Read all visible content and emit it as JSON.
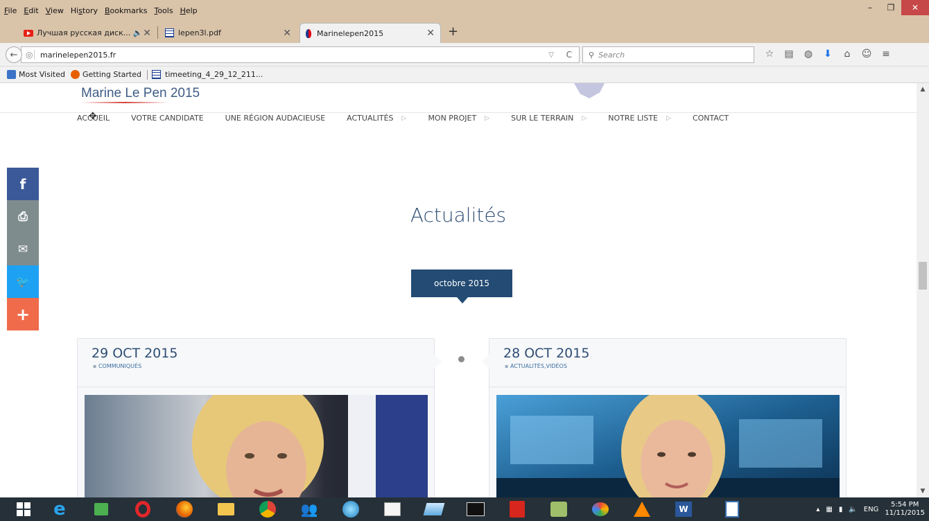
{
  "menubar": {
    "items": [
      {
        "pre": "",
        "u": "F",
        "post": "ile"
      },
      {
        "pre": "",
        "u": "E",
        "post": "dit"
      },
      {
        "pre": "",
        "u": "V",
        "post": "iew"
      },
      {
        "pre": "Hi",
        "u": "s",
        "post": "tory"
      },
      {
        "pre": "",
        "u": "B",
        "post": "ookmarks"
      },
      {
        "pre": "",
        "u": "T",
        "post": "ools"
      },
      {
        "pre": "",
        "u": "H",
        "post": "elp"
      }
    ]
  },
  "tabs": [
    {
      "label": "Лучшая русская диск... 🔈",
      "close": "✕"
    },
    {
      "label": "lepen3l.pdf",
      "close": "✕"
    },
    {
      "label": "Marinelepen2015",
      "close": "✕"
    }
  ],
  "new_tab": "+",
  "navbar": {
    "back": "←",
    "url": "marinelepen2015.fr",
    "search_placeholder": "Search",
    "dropdown": "▽",
    "reload": "C"
  },
  "toolbar_icons": [
    "☆",
    "▤",
    "◍",
    "⬇",
    "⌂",
    "☺",
    "≡"
  ],
  "bookmarks": [
    {
      "label": "Most Visited",
      "color": "#3b73c8"
    },
    {
      "label": "Getting Started",
      "color": "#e66000"
    },
    {
      "label": "timeeting_4_29_12_211...",
      "color": "#1b3d8f"
    }
  ],
  "site": {
    "logo": "Marine Le Pen 2015",
    "nav": [
      {
        "label": "ACCUEIL",
        "arrow": ""
      },
      {
        "label": "VOTRE CANDIDATE",
        "arrow": ""
      },
      {
        "label": "UNE RÉGION AUDACIEUSE",
        "arrow": ""
      },
      {
        "label": "ACTUALITÉS",
        "arrow": "▷"
      },
      {
        "label": "MON PROJET",
        "arrow": "▷"
      },
      {
        "label": "SUR LE TERRAIN",
        "arrow": "▷"
      },
      {
        "label": "NOTRE LISTE",
        "arrow": "▷"
      },
      {
        "label": "CONTACT",
        "arrow": ""
      }
    ],
    "social": [
      {
        "icon": "f",
        "name": "facebook-icon",
        "color": "#3b5998"
      },
      {
        "icon": "⎙",
        "name": "print-icon",
        "color": "#7f8c8d"
      },
      {
        "icon": "✉",
        "name": "email-icon",
        "color": "#7f8c8d"
      },
      {
        "icon": "🐦",
        "name": "twitter-icon",
        "color": "#1da1f2"
      },
      {
        "icon": "+",
        "name": "share-more-icon",
        "color": "#ef6b4a"
      }
    ],
    "section_title": "Actualités",
    "month": "octobre 2015",
    "posts": [
      {
        "date": "29 OCT 2015",
        "category": "COMMUNIQUÉS"
      },
      {
        "date": "28 OCT 2015",
        "category": "ACTUALITÉS,VIDÉOS"
      }
    ]
  },
  "taskbar": {
    "lang": "ENG",
    "time": "5:54 PM",
    "date": "11/11/2015"
  }
}
